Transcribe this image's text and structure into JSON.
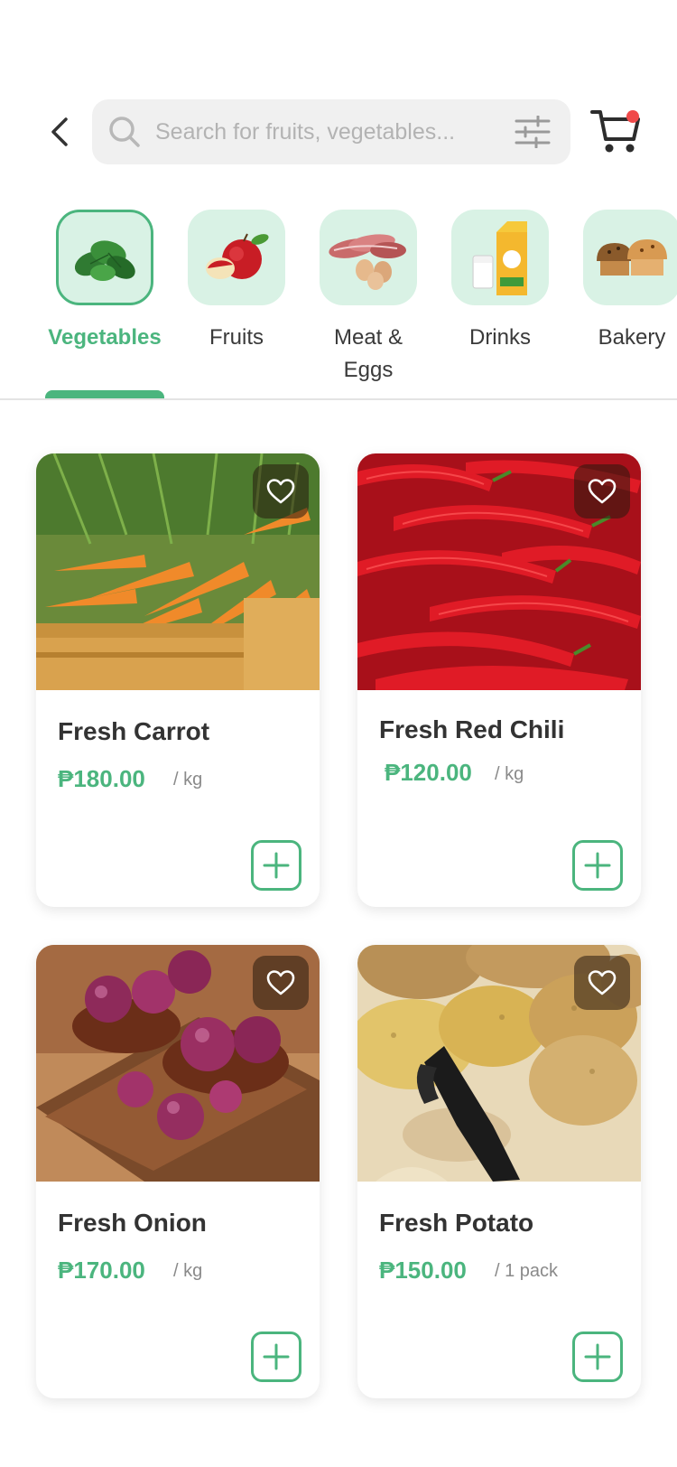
{
  "search": {
    "placeholder": "Search for fruits, vegetables..."
  },
  "categories": [
    {
      "label": "Vegetables"
    },
    {
      "label": "Fruits"
    },
    {
      "label": "Meat &\nEggs"
    },
    {
      "label": "Drinks"
    },
    {
      "label": "Bakery"
    }
  ],
  "products": [
    {
      "name": "Fresh Carrot",
      "price": "₱180.00",
      "unit": "/ kg"
    },
    {
      "name": "Fresh Red Chili",
      "price": "₱120.00",
      "unit": "/ kg"
    },
    {
      "name": "Fresh Onion",
      "price": "₱170.00",
      "unit": "/ kg"
    },
    {
      "name": "Fresh Potato",
      "price": "₱150.00",
      "unit": "/ 1 pack"
    }
  ],
  "colors": {
    "accent": "#4bb57e",
    "tile": "#d9f2e5",
    "badge": "#f04a4a"
  },
  "icons": {
    "back": "chevron-left-icon",
    "search": "search-icon",
    "filter": "sliders-icon",
    "cart": "cart-icon",
    "favorite": "heart-icon",
    "add": "plus-icon"
  }
}
